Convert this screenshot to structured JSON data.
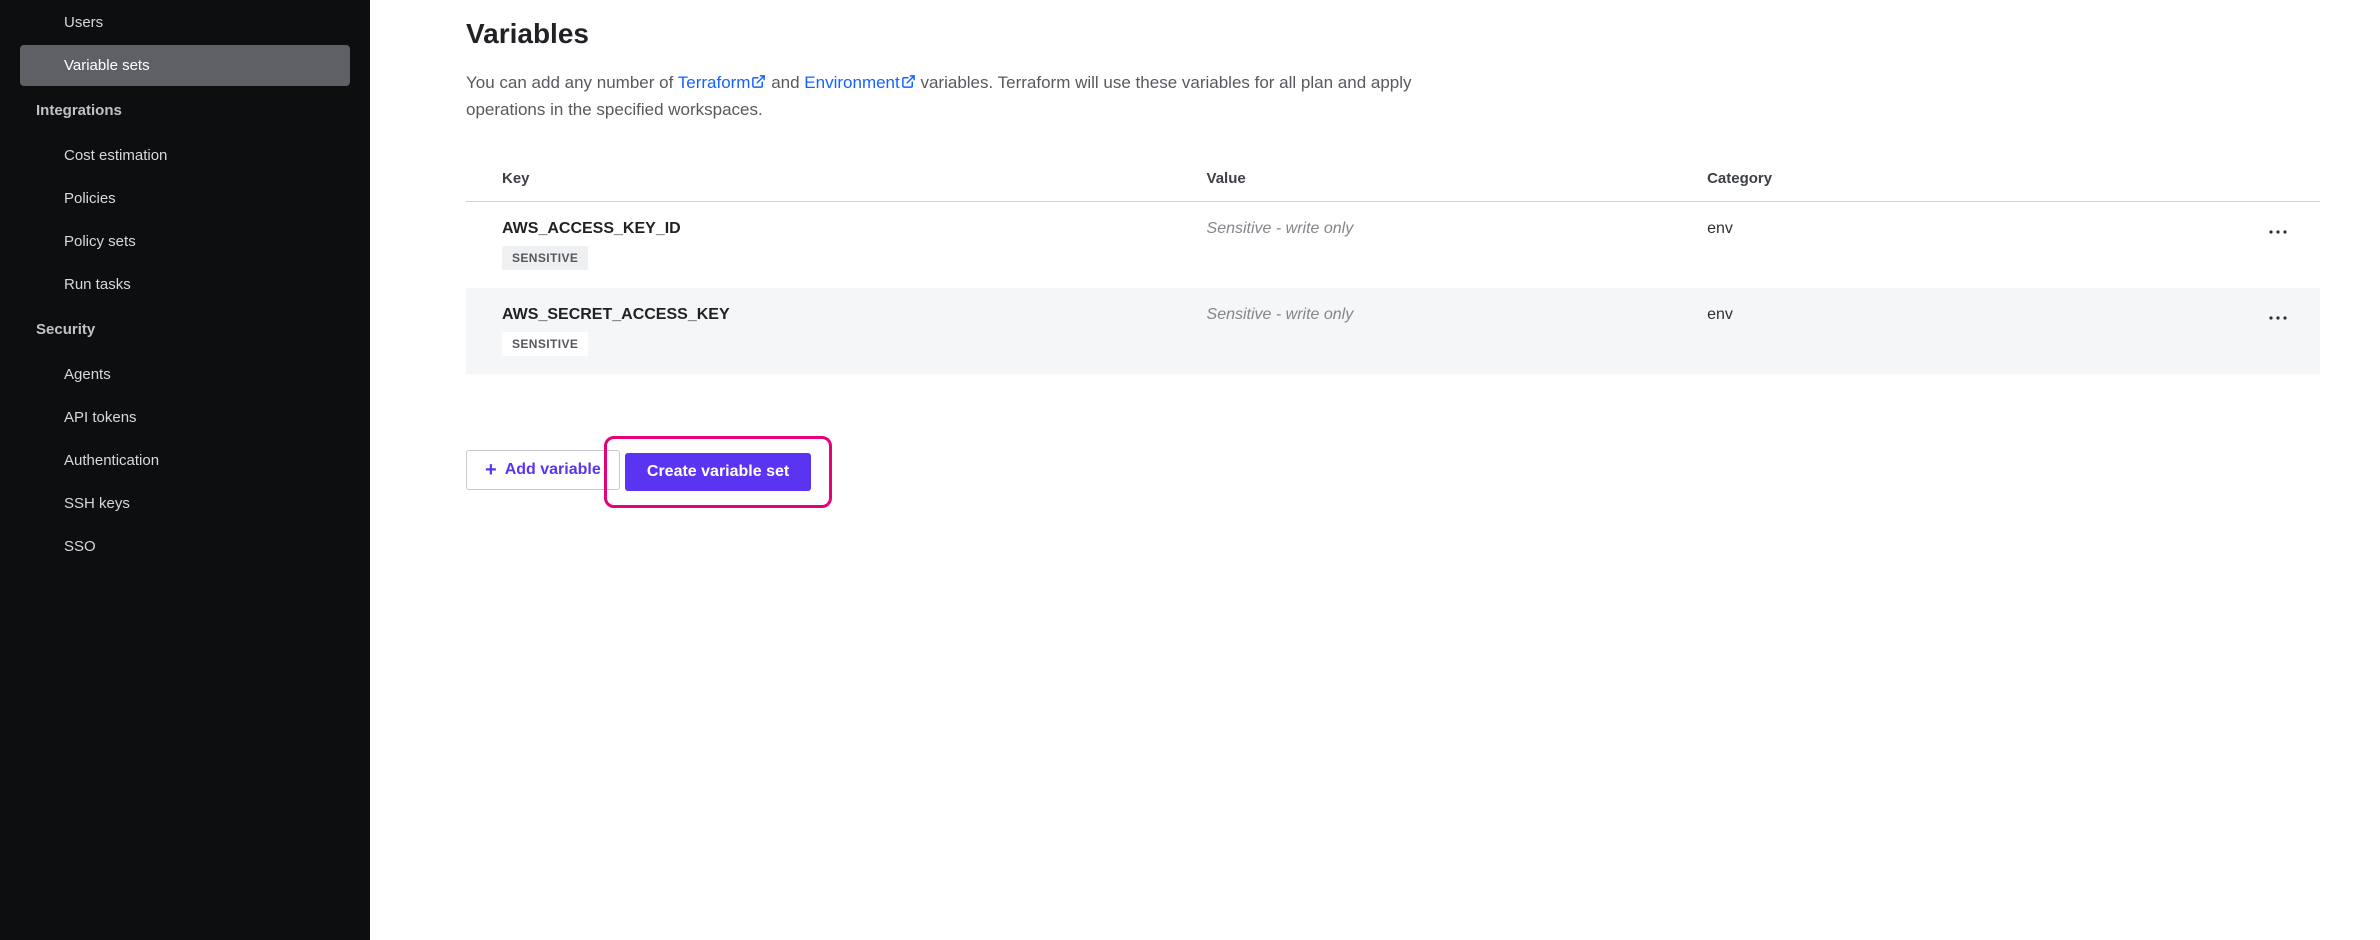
{
  "sidebar": {
    "items": [
      {
        "label": "Users",
        "type": "item",
        "active": false
      },
      {
        "label": "Variable sets",
        "type": "item",
        "active": true
      },
      {
        "label": "Integrations",
        "type": "header"
      },
      {
        "label": "Cost estimation",
        "type": "item",
        "active": false
      },
      {
        "label": "Policies",
        "type": "item",
        "active": false
      },
      {
        "label": "Policy sets",
        "type": "item",
        "active": false
      },
      {
        "label": "Run tasks",
        "type": "item",
        "active": false
      },
      {
        "label": "Security",
        "type": "header"
      },
      {
        "label": "Agents",
        "type": "item",
        "active": false
      },
      {
        "label": "API tokens",
        "type": "item",
        "active": false
      },
      {
        "label": "Authentication",
        "type": "item",
        "active": false
      },
      {
        "label": "SSH keys",
        "type": "item",
        "active": false
      },
      {
        "label": "SSO",
        "type": "item",
        "active": false
      }
    ]
  },
  "page": {
    "title": "Variables",
    "description": {
      "pre": "You can add any number of ",
      "link1": "Terraform",
      "mid1": " and ",
      "link2": "Environment",
      "post": " variables. Terraform will use these variables for all plan and apply operations in the specified workspaces."
    }
  },
  "table": {
    "headers": {
      "key": "Key",
      "value": "Value",
      "category": "Category"
    },
    "rows": [
      {
        "key": "AWS_ACCESS_KEY_ID",
        "sensitive_badge": "SENSITIVE",
        "value": "Sensitive - write only",
        "category": "env"
      },
      {
        "key": "AWS_SECRET_ACCESS_KEY",
        "sensitive_badge": "SENSITIVE",
        "value": "Sensitive - write only",
        "category": "env"
      }
    ]
  },
  "buttons": {
    "add_variable": "Add variable",
    "create_variable_set": "Create variable set"
  }
}
